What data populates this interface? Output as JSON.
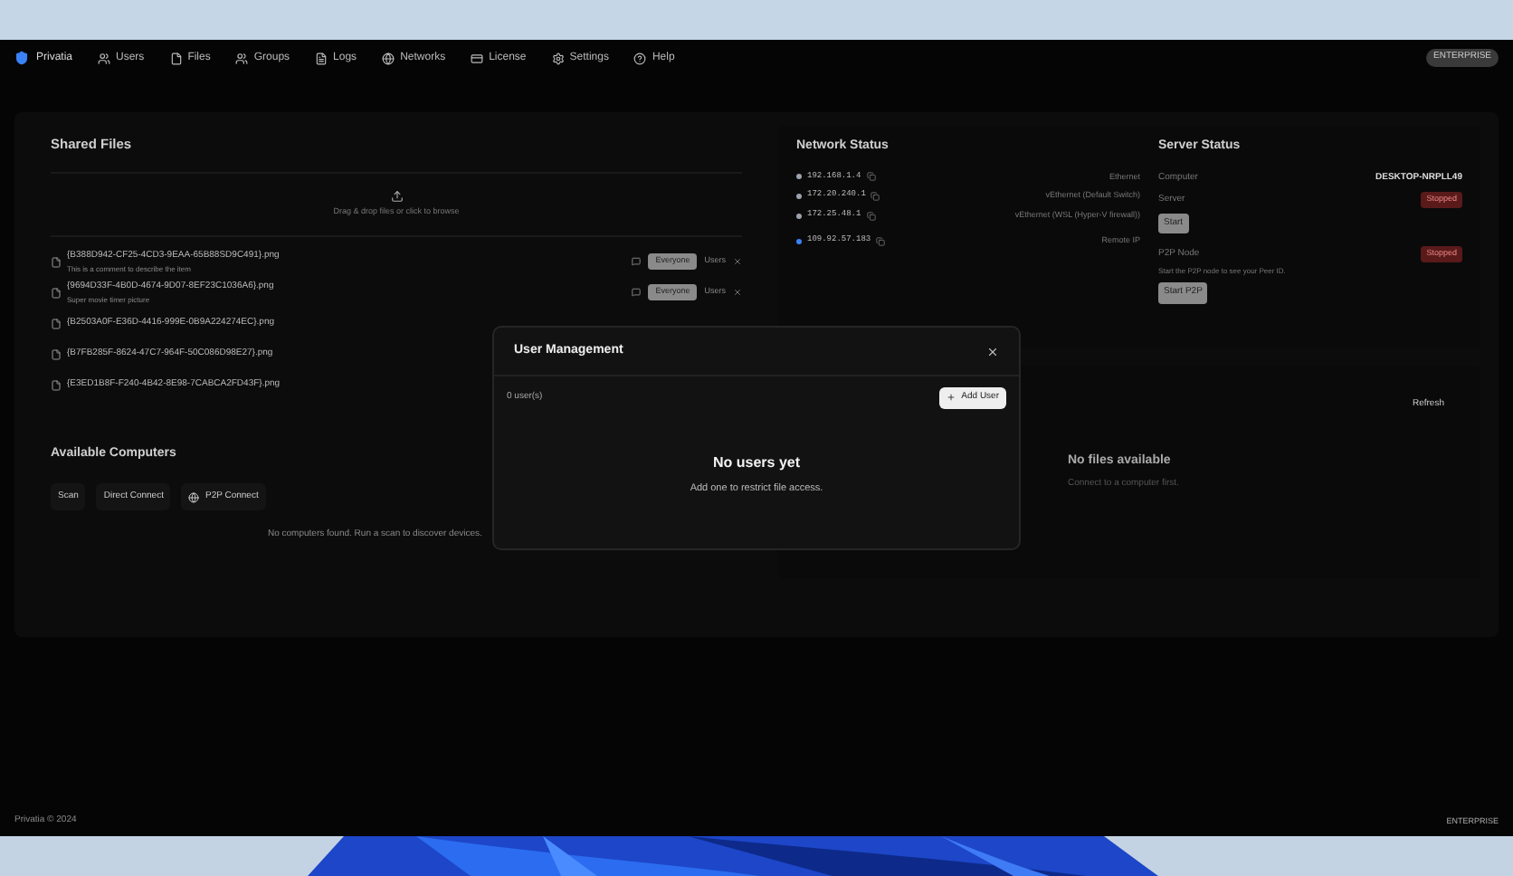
{
  "nav": {
    "brand": "Privatia",
    "items": [
      {
        "label": "Users"
      },
      {
        "label": "Files"
      },
      {
        "label": "Groups"
      },
      {
        "label": "Logs"
      },
      {
        "label": "Networks"
      },
      {
        "label": "License"
      },
      {
        "label": "Settings"
      },
      {
        "label": "Help"
      }
    ],
    "badge": "ENTERPRISE"
  },
  "shared_files": {
    "title": "Shared Files",
    "dropzone": "Drag & drop files or click to browse",
    "files": [
      {
        "name": "{B388D942-CF25-4CD3-9EAA-65B88SD9C491}.png",
        "comment": "This is a comment to describe the item",
        "access": "Everyone",
        "users": "Users"
      },
      {
        "name": "{9694D33F-4B0D-4674-9D07-8EF23C1036A6}.png",
        "comment": "Super movie timer picture",
        "access": "Everyone",
        "users": "Users"
      },
      {
        "name": "{B2503A0F-E36D-4416-999E-0B9A224274EC}.png"
      },
      {
        "name": "{B7FB285F-8624-47C7-964F-50C086D98E27}.png"
      },
      {
        "name": "{E3ED1B8F-F240-4B42-8E98-7CABCA2FD43F}.png"
      }
    ]
  },
  "network_status": {
    "title": "Network Status",
    "addresses": [
      {
        "ip": "192.168.1.4",
        "adapter": "Ethernet",
        "color": "#9ca3af"
      },
      {
        "ip": "172.20.240.1",
        "adapter": "vEthernet (Default Switch)",
        "color": "#9ca3af"
      },
      {
        "ip": "172.25.48.1",
        "adapter": "vEthernet (WSL (Hyper-V firewall))",
        "color": "#9ca3af"
      },
      {
        "ip": "109.92.57.183",
        "adapter": "Remote IP",
        "color": "#3b82f6"
      }
    ]
  },
  "server_status": {
    "title": "Server Status",
    "computer_label": "Computer",
    "computer": "DESKTOP-NRPLL49",
    "server_label": "Server",
    "server_state": "Stopped",
    "start": "Start",
    "p2p_label": "P2P Node",
    "p2p_state": "Stopped",
    "p2p_hint": "Start the P2P node to see your Peer ID.",
    "start_p2p": "Start P2P"
  },
  "available_computers": {
    "title": "Available Computers",
    "buttons": [
      "Scan",
      "Direct Connect",
      "P2P Connect"
    ],
    "empty": "No computers found. Run a scan to discover devices."
  },
  "remote_files": {
    "refresh": "Refresh",
    "empty_title": "No files available",
    "empty_hint": "Connect to a computer first."
  },
  "footer": {
    "copyright": "Privatia © 2024",
    "badge": "ENTERPRISE"
  },
  "dialog": {
    "title": "User Management",
    "count": "0 user(s)",
    "add": "Add User",
    "empty_title": "No users yet",
    "empty_hint": "Add one to restrict file access."
  }
}
